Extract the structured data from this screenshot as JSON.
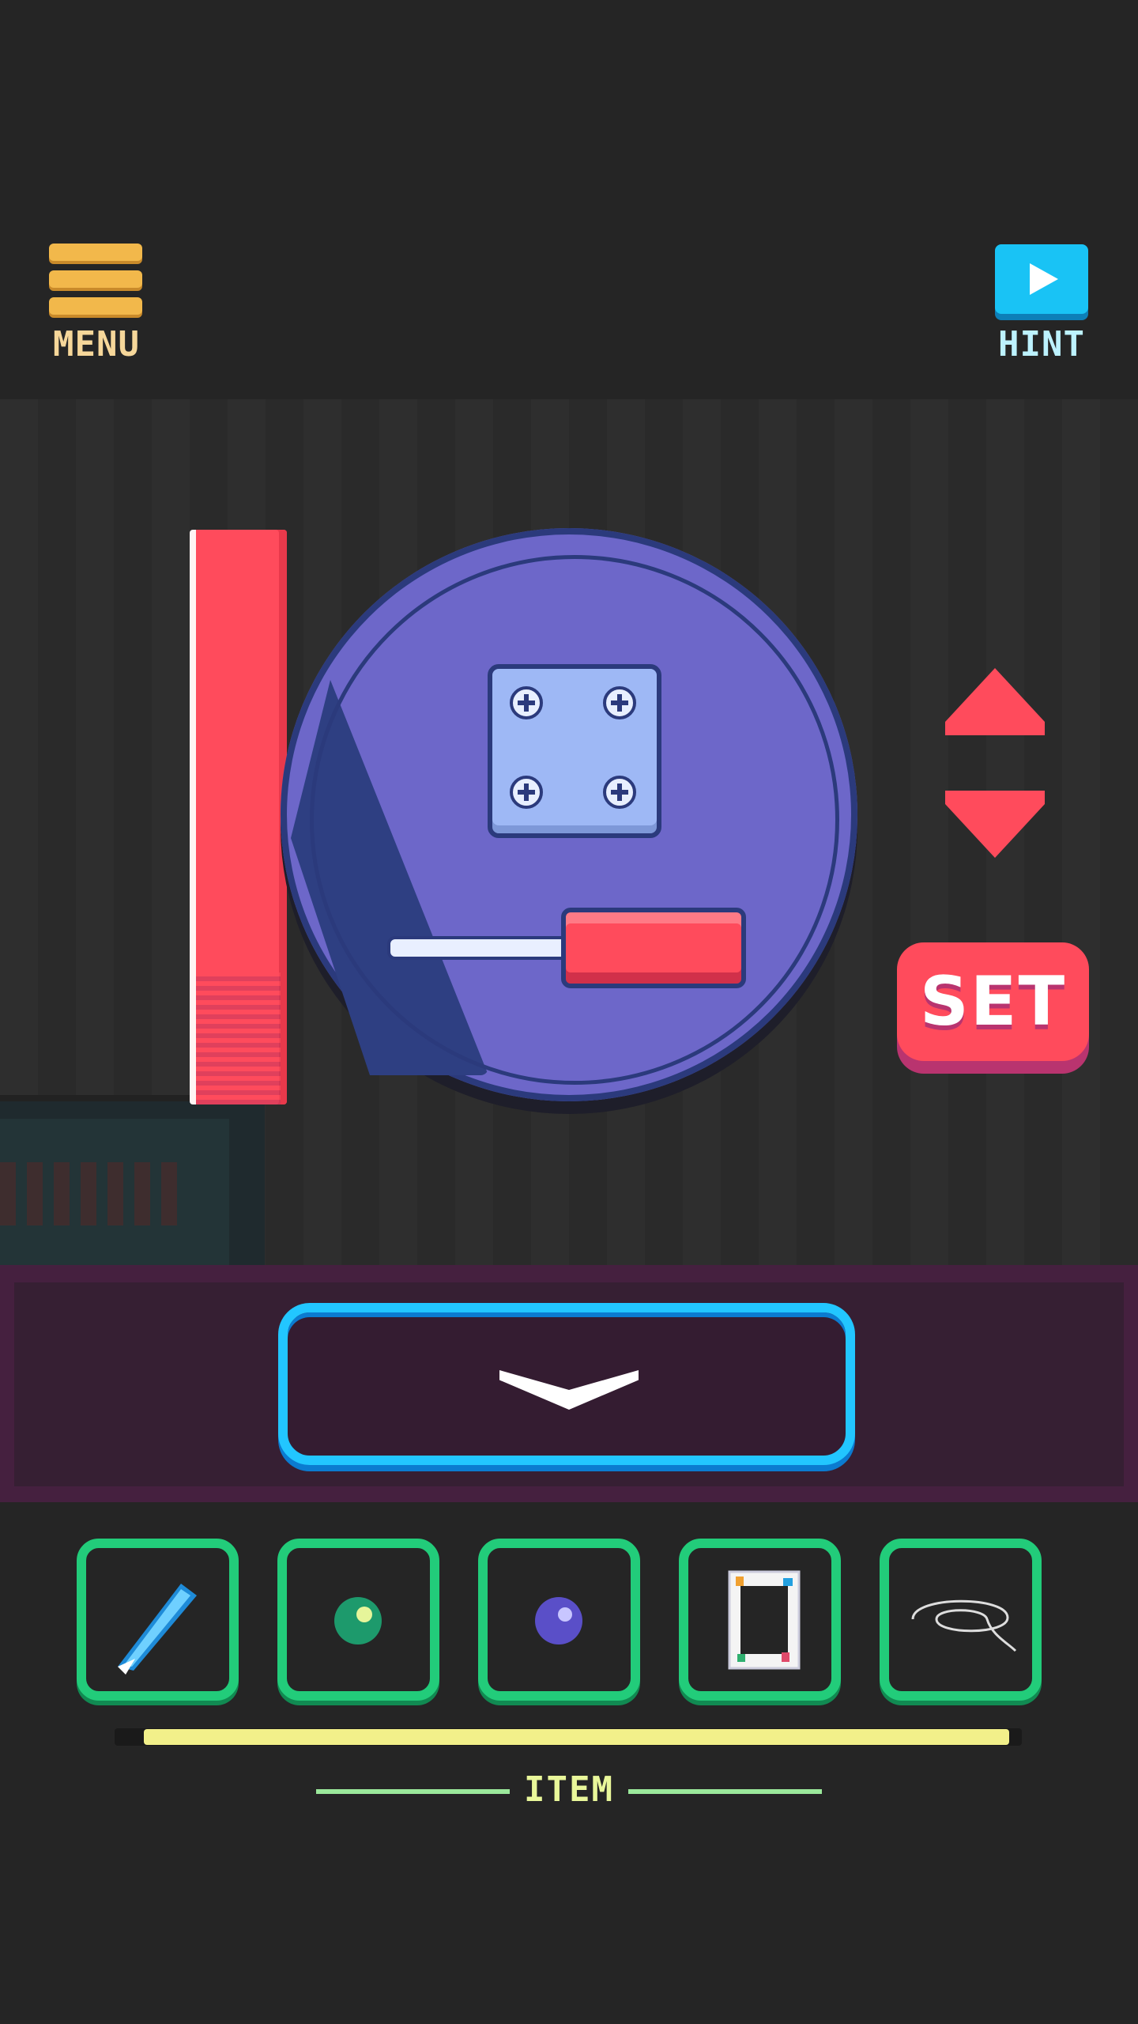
{
  "header": {
    "menu_label": "MENU",
    "hint_label": "HINT",
    "menu_icon": "hamburger-icon",
    "hint_icon": "play-icon"
  },
  "scene": {
    "objects": [
      "red-bar",
      "blue-plate",
      "metal-plate-with-screws",
      "screwdriver"
    ],
    "controls": {
      "up_icon": "triangle-up-icon",
      "down_icon": "triangle-down-icon",
      "set_label": "SET"
    }
  },
  "navigation": {
    "down_icon": "chevron-down-icon"
  },
  "inventory": {
    "label": "ITEM",
    "progress": 1.0,
    "slots": [
      {
        "icon": "cutter-knife-icon"
      },
      {
        "icon": "green-ball-icon"
      },
      {
        "icon": "purple-ball-icon"
      },
      {
        "icon": "playing-card-icon"
      },
      {
        "icon": "string-icon"
      }
    ]
  },
  "colors": {
    "background": "#252525",
    "accent_red": "#ff4b5c",
    "accent_cyan": "#22c6ff",
    "slot_green": "#22cc7a",
    "menu_gold": "#f2b84b",
    "plate_purple": "#6d67c9"
  }
}
